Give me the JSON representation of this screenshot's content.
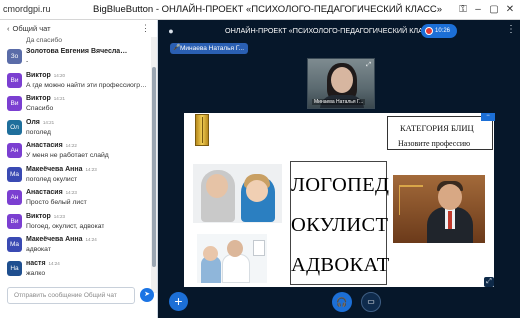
{
  "browser": {
    "url": "cmordgpi.ru",
    "title": "BigBlueButton - ОНЛАЙН-ПРОЕКТ «ПСИХОЛОГО-ПЕДАГОГИЧЕСКИЙ КЛАСС»",
    "icons": [
      "key-icon",
      "minimize-icon",
      "maximize-icon",
      "close-icon"
    ]
  },
  "chat": {
    "header": "Общий чат",
    "partial_text": "Да спасибо",
    "input_placeholder": "Отправить сообщение Общий чат",
    "messages": [
      {
        "avatar": "Зо",
        "color": "#5a6ca8",
        "name": "Золотова Евгения Вячеславо...",
        "time": "14:20",
        "text": "-"
      },
      {
        "avatar": "Ви",
        "color": "#7b3fd1",
        "name": "Виктор",
        "time": "14:20",
        "text": "А где можно найти эти профессиограммы?"
      },
      {
        "avatar": "Ви",
        "color": "#7b3fd1",
        "name": "Виктор",
        "time": "14:21",
        "text": "Спасибо"
      },
      {
        "avatar": "Ол",
        "color": "#1f6f9c",
        "name": "Оля",
        "time": "14:21",
        "text": "поголед"
      },
      {
        "avatar": "Ан",
        "color": "#7b3fd1",
        "name": "Анастасия",
        "time": "14:22",
        "text": "У меня не работает слайд"
      },
      {
        "avatar": "Ма",
        "color": "#3a4ab3",
        "name": "Макеёчева Анна",
        "time": "14:23",
        "text": "поголед окулист"
      },
      {
        "avatar": "Ан",
        "color": "#7b3fd1",
        "name": "Анастасия",
        "time": "14:23",
        "text": "Просто белый лист"
      },
      {
        "avatar": "Ви",
        "color": "#7b3fd1",
        "name": "Виктор",
        "time": "14:23",
        "text": "Погоед, окулист, адвокат"
      },
      {
        "avatar": "Ма",
        "color": "#3a4ab3",
        "name": "Макеёчева Анна",
        "time": "14:24",
        "text": "адвокат"
      },
      {
        "avatar": "На",
        "color": "#1f4f8f",
        "name": "настя",
        "time": "14:24",
        "text": "жалко"
      }
    ]
  },
  "main": {
    "meeting_title": "ОНЛАЙН-ПРОЕКТ «ПСИХОЛОГО-ПЕДАГОГИЧЕСКИЙ КЛА...",
    "recording_time": "10:26",
    "presenter_name": "Минаева Наталья Г...",
    "webcam_name": "Минаева Наталья Г..."
  },
  "slide": {
    "category_line1": "КАТЕГОРИЯ БЛИЦ",
    "category_line2": "Назовите профессию",
    "words": [
      "ЛОГОПЕД",
      "ОКУЛИСТ",
      "АДВОКАТ"
    ]
  },
  "colors": {
    "accent": "#1c6fd6",
    "background": "#06172a",
    "record": "#e53935"
  }
}
